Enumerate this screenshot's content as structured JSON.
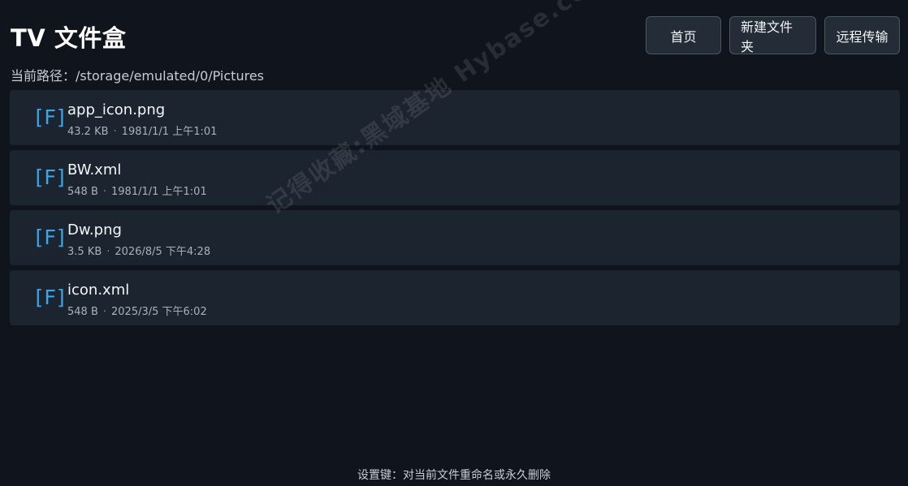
{
  "header": {
    "title": "TV 文件盒"
  },
  "toolbar": {
    "home_label": "首页",
    "new_folder_label": "新建文件夹",
    "remote_label": "远程传输"
  },
  "path": {
    "label": "当前路径：",
    "value": "/storage/emulated/0/Pictures"
  },
  "files": [
    {
      "icon": "[F]",
      "name": "app_icon.png",
      "size": "43.2 KB",
      "sep": "·",
      "date": "1981/1/1 上午1:01"
    },
    {
      "icon": "[F]",
      "name": "BW.xml",
      "size": "548 B",
      "sep": "·",
      "date": "1981/1/1 上午1:01"
    },
    {
      "icon": "[F]",
      "name": "Dw.png",
      "size": "3.5 KB",
      "sep": "·",
      "date": "2026/8/5 下午4:28"
    },
    {
      "icon": "[F]",
      "name": "icon.xml",
      "size": "548 B",
      "sep": "·",
      "date": "2025/3/5 下午6:02"
    }
  ],
  "watermark": "记得收藏:黑域基地  Hybase.com",
  "footer": {
    "hint": "设置键：对当前文件重命名或永久删除"
  },
  "colors": {
    "background": "#10151d",
    "row": "#1c2430",
    "icon_accent": "#3aa6e8",
    "button_bg": "#242c38"
  }
}
